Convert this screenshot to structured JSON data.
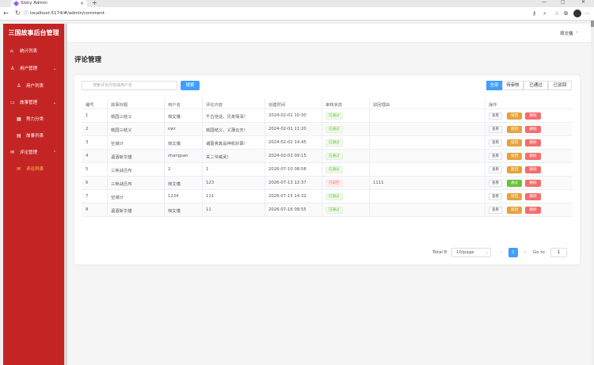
{
  "browser": {
    "tab_title": "Story Admin",
    "tab_close": "×",
    "new_tab": "+",
    "url": "localhost:5174/#/admin/comment",
    "minimize": "—",
    "maximize": "▢",
    "close": "✕",
    "back": "←",
    "forward": "→",
    "reload": "↻"
  },
  "sidebar": {
    "logo": "三国故事后台管理",
    "items": [
      {
        "label": "统计列表",
        "icon": "home-icon",
        "glyph": "⌂"
      },
      {
        "label": "用户管理",
        "icon": "user-icon",
        "glyph": "♙",
        "arrow": "⌄"
      },
      {
        "label": "用户列表",
        "icon": "user-icon",
        "glyph": "♙"
      },
      {
        "label": "故事管理",
        "icon": "book-icon",
        "glyph": "▭",
        "arrow": "⌄"
      },
      {
        "label": "势力分类",
        "icon": "grid-icon",
        "glyph": "▦"
      },
      {
        "label": "故事列表",
        "icon": "document-icon",
        "glyph": "▤"
      },
      {
        "label": "评论管理",
        "icon": "mail-icon",
        "glyph": "✉",
        "arrow": "⌃"
      },
      {
        "label": "评论列表",
        "icon": "mail-icon",
        "glyph": "✉"
      }
    ]
  },
  "header": {
    "user_name": "琐文儀",
    "arrow": "⌄"
  },
  "page": {
    "title": "评论管理"
  },
  "toolbar": {
    "search_placeholder": "搜索评论内容或用户名",
    "search_label": "搜索",
    "filters": [
      "全部",
      "待审核",
      "已通过",
      "已驳回"
    ],
    "active_filter": "全部"
  },
  "table": {
    "headers": [
      "编号",
      "故事标题",
      "用户名",
      "评论内容",
      "创建时间",
      "审核状态",
      "驳回理由",
      "操作"
    ],
    "rows": [
      {
        "id": "1",
        "title": "桃园三结义",
        "user": "琐文儀",
        "content": "千古佳话，兄弟情深！",
        "time": "2024-02-01 10:30",
        "status": "已通过",
        "reason": "",
        "action2": "驳回"
      },
      {
        "id": "2",
        "title": "桃园三结义",
        "user": "ewr",
        "content": "桃园结义，义薄云天！",
        "time": "2024-02-01 11:20",
        "status": "已通过",
        "reason": "",
        "action2": "驳回"
      },
      {
        "id": "3",
        "title": "空城计",
        "user": "琐文儀",
        "content": "诸葛亮真是神机妙算！",
        "time": "2024-02-02 14:45",
        "status": "已通过",
        "reason": "",
        "action2": "驳回"
      },
      {
        "id": "4",
        "title": "温酒斩华雄",
        "user": "zhangsan",
        "content": "关二爷威武！",
        "time": "2024-02-03 09:15",
        "status": "已通过",
        "reason": "",
        "action2": "驳回"
      },
      {
        "id": "5",
        "title": "三英战吕布",
        "user": "2",
        "content": "1",
        "time": "2026-07-10 08:58",
        "status": "已通过",
        "reason": "",
        "action2": "驳回"
      },
      {
        "id": "6",
        "title": "三英战吕布",
        "user": "琐文儀",
        "content": "123",
        "time": "2026-07-13 12:37",
        "status": "已驳回",
        "reason": "1111",
        "action2": "通过"
      },
      {
        "id": "7",
        "title": "空城计",
        "user": "1234",
        "content": "111",
        "time": "2026-07-15 14:32",
        "status": "已通过",
        "reason": "",
        "action2": "驳回"
      },
      {
        "id": "8",
        "title": "温酒斩华雄",
        "user": "琐文儀",
        "content": "11",
        "time": "2026-07-16 08:55",
        "status": "已通过",
        "reason": "",
        "action2": "驳回"
      }
    ],
    "view_label": "查看",
    "delete_label": "删除"
  },
  "pagination": {
    "total": "Total 8",
    "page_size": "10/page",
    "current_page": "1",
    "goto_label": "Go to",
    "goto_value": "1",
    "prev": "‹",
    "next": "›",
    "dropdown": "⌄"
  },
  "colors": {
    "sidebar_bg": "#c32525",
    "primary": "#409eff",
    "success": "#67c23a",
    "warning": "#e6a23c",
    "danger": "#f56c6c",
    "active_menu": "#ffd04b"
  }
}
